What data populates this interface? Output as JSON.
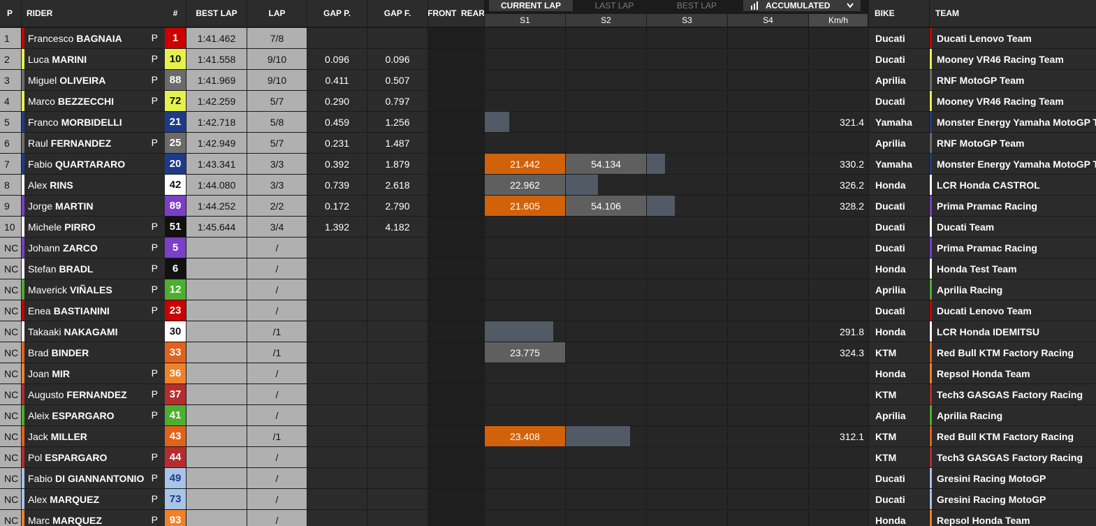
{
  "headers": {
    "pos": "P",
    "rider": "RIDER",
    "number": "#",
    "best_lap": "BEST LAP",
    "lap": "LAP",
    "gap_p": "GAP P.",
    "gap_f": "GAP F.",
    "front_rear": "FRONT  REAR",
    "bike": "BIKE",
    "team": "TEAM"
  },
  "lap_tabs": {
    "current": "CURRENT LAP",
    "last": "LAST LAP",
    "best": "BEST LAP",
    "mode": "ACCUMULATED"
  },
  "sector_headers": [
    "S1",
    "S2",
    "S3",
    "S4",
    "Km/h"
  ],
  "colors": {
    "orange_sector": "#d2620a",
    "gray_sector": "#5f5f5f",
    "slate_sector": "#525a66"
  },
  "riders": [
    {
      "pos": "1",
      "first": "Francesco",
      "last": "BAGNAIA",
      "p": "P",
      "num": "1",
      "num_bg": "#cc0000",
      "num_fg": "#ffffff",
      "accent": "#cc0000",
      "best": "1:41.462",
      "lap": "7/8",
      "gap_p": "",
      "gap_f": "",
      "s1": "",
      "s1_fill": 0,
      "s1_color": "",
      "s2": "",
      "s2_fill": 0,
      "s2_color": "",
      "s3_fill": 0,
      "speed": "",
      "bike": "Ducati",
      "team": "Ducati Lenovo Team",
      "team_accent": "#cc0000"
    },
    {
      "pos": "2",
      "first": "Luca",
      "last": "MARINI",
      "p": "P",
      "num": "10",
      "num_bg": "#e6f24c",
      "num_fg": "#111111",
      "accent": "#e6f24c",
      "best": "1:41.558",
      "lap": "9/10",
      "gap_p": "0.096",
      "gap_f": "0.096",
      "s1": "",
      "s1_fill": 0,
      "s1_color": "",
      "s2": "",
      "s2_fill": 0,
      "s2_color": "",
      "s3_fill": 0,
      "speed": "",
      "bike": "Ducati",
      "team": "Mooney VR46 Racing Team",
      "team_accent": "#e6f24c"
    },
    {
      "pos": "3",
      "first": "Miguel",
      "last": "OLIVEIRA",
      "p": "P",
      "num": "88",
      "num_bg": "#6b6b6b",
      "num_fg": "#ffffff",
      "accent": "#6b6b6b",
      "best": "1:41.969",
      "lap": "9/10",
      "gap_p": "0.411",
      "gap_f": "0.507",
      "s1": "",
      "s1_fill": 0,
      "s1_color": "",
      "s2": "",
      "s2_fill": 0,
      "s2_color": "",
      "s3_fill": 0,
      "speed": "",
      "bike": "Aprilia",
      "team": "RNF MotoGP Team",
      "team_accent": "#6b6b6b"
    },
    {
      "pos": "4",
      "first": "Marco",
      "last": "BEZZECCHI",
      "p": "P",
      "num": "72",
      "num_bg": "#e6f24c",
      "num_fg": "#111111",
      "accent": "#e6f24c",
      "best": "1:42.259",
      "lap": "5/7",
      "gap_p": "0.290",
      "gap_f": "0.797",
      "s1": "",
      "s1_fill": 0,
      "s1_color": "",
      "s2": "",
      "s2_fill": 0,
      "s2_color": "",
      "s3_fill": 0,
      "speed": "",
      "bike": "Ducati",
      "team": "Mooney VR46 Racing Team",
      "team_accent": "#e6f24c"
    },
    {
      "pos": "5",
      "first": "Franco",
      "last": "MORBIDELLI",
      "p": "",
      "num": "21",
      "num_bg": "#1e3a8a",
      "num_fg": "#ffffff",
      "accent": "#1e3a8a",
      "best": "1:42.718",
      "lap": "5/8",
      "gap_p": "0.459",
      "gap_f": "1.256",
      "s1": "",
      "s1_fill": 0.3,
      "s1_color": "#525a66",
      "s2": "",
      "s2_fill": 0,
      "s2_color": "",
      "s3_fill": 0,
      "speed": "321.4",
      "bike": "Yamaha",
      "team": "Monster Energy Yamaha MotoGP T...",
      "team_accent": "#1e3a8a"
    },
    {
      "pos": "6",
      "first": "Raul",
      "last": "FERNANDEZ",
      "p": "P",
      "num": "25",
      "num_bg": "#6b6b6b",
      "num_fg": "#ffffff",
      "accent": "#6b6b6b",
      "best": "1:42.949",
      "lap": "5/7",
      "gap_p": "0.231",
      "gap_f": "1.487",
      "s1": "",
      "s1_fill": 0,
      "s1_color": "",
      "s2": "",
      "s2_fill": 0,
      "s2_color": "",
      "s3_fill": 0,
      "speed": "",
      "bike": "Aprilia",
      "team": "RNF MotoGP Team",
      "team_accent": "#6b6b6b"
    },
    {
      "pos": "7",
      "first": "Fabio",
      "last": "QUARTARARO",
      "p": "",
      "num": "20",
      "num_bg": "#1e3a8a",
      "num_fg": "#ffffff",
      "accent": "#1e3a8a",
      "best": "1:43.341",
      "lap": "3/3",
      "gap_p": "0.392",
      "gap_f": "1.879",
      "s1": "21.442",
      "s1_fill": 1,
      "s1_color": "#d2620a",
      "s2": "54.134",
      "s2_fill": 1,
      "s2_color": "#5f5f5f",
      "s3_fill": 0.23,
      "speed": "330.2",
      "bike": "Yamaha",
      "team": "Monster Energy Yamaha MotoGP T...",
      "team_accent": "#1e3a8a"
    },
    {
      "pos": "8",
      "first": "Alex",
      "last": "RINS",
      "p": "",
      "num": "42",
      "num_bg": "#ffffff",
      "num_fg": "#111111",
      "accent": "#ffffff",
      "best": "1:44.080",
      "lap": "3/3",
      "gap_p": "0.739",
      "gap_f": "2.618",
      "s1": "22.962",
      "s1_fill": 1,
      "s1_color": "#5f5f5f",
      "s2": "",
      "s2_fill": 0.4,
      "s2_color": "#525a66",
      "s3_fill": 0,
      "speed": "326.2",
      "bike": "Honda",
      "team": "LCR Honda CASTROL",
      "team_accent": "#ffffff"
    },
    {
      "pos": "9",
      "first": "Jorge",
      "last": "MARTIN",
      "p": "",
      "num": "89",
      "num_bg": "#7b3fc9",
      "num_fg": "#ffffff",
      "accent": "#7b3fc9",
      "best": "1:44.252",
      "lap": "2/2",
      "gap_p": "0.172",
      "gap_f": "2.790",
      "s1": "21.605",
      "s1_fill": 1,
      "s1_color": "#d2620a",
      "s2": "54.106",
      "s2_fill": 1,
      "s2_color": "#5f5f5f",
      "s3_fill": 0.35,
      "speed": "328.2",
      "bike": "Ducati",
      "team": "Prima Pramac Racing",
      "team_accent": "#7b3fc9"
    },
    {
      "pos": "10",
      "first": "Michele",
      "last": "PIRRO",
      "p": "P",
      "num": "51",
      "num_bg": "#111111",
      "num_fg": "#ffffff",
      "accent": "#ffffff",
      "best": "1:45.644",
      "lap": "3/4",
      "gap_p": "1.392",
      "gap_f": "4.182",
      "s1": "",
      "s1_fill": 0,
      "s1_color": "",
      "s2": "",
      "s2_fill": 0,
      "s2_color": "",
      "s3_fill": 0,
      "speed": "",
      "bike": "Ducati",
      "team": "Ducati Team",
      "team_accent": "#ffffff"
    },
    {
      "pos": "NC",
      "first": "Johann",
      "last": "ZARCO",
      "p": "P",
      "num": "5",
      "num_bg": "#7b3fc9",
      "num_fg": "#ffffff",
      "accent": "#7b3fc9",
      "best": "",
      "lap": "/",
      "gap_p": "",
      "gap_f": "",
      "s1": "",
      "s1_fill": 0,
      "s1_color": "",
      "s2": "",
      "s2_fill": 0,
      "s2_color": "",
      "s3_fill": 0,
      "speed": "",
      "bike": "Ducati",
      "team": "Prima Pramac Racing",
      "team_accent": "#7b3fc9"
    },
    {
      "pos": "NC",
      "first": "Stefan",
      "last": "BRADL",
      "p": "P",
      "num": "6",
      "num_bg": "#111111",
      "num_fg": "#ffffff",
      "accent": "#ffffff",
      "best": "",
      "lap": "/",
      "gap_p": "",
      "gap_f": "",
      "s1": "",
      "s1_fill": 0,
      "s1_color": "",
      "s2": "",
      "s2_fill": 0,
      "s2_color": "",
      "s3_fill": 0,
      "speed": "",
      "bike": "Honda",
      "team": "Honda Test Team",
      "team_accent": "#ffffff"
    },
    {
      "pos": "NC",
      "first": "Maverick",
      "last": "VIÑALES",
      "p": "P",
      "num": "12",
      "num_bg": "#4caf2e",
      "num_fg": "#ffffff",
      "accent": "#4caf2e",
      "best": "",
      "lap": "/",
      "gap_p": "",
      "gap_f": "",
      "s1": "",
      "s1_fill": 0,
      "s1_color": "",
      "s2": "",
      "s2_fill": 0,
      "s2_color": "",
      "s3_fill": 0,
      "speed": "",
      "bike": "Aprilia",
      "team": "Aprilia Racing",
      "team_accent": "#4caf2e"
    },
    {
      "pos": "NC",
      "first": "Enea",
      "last": "BASTIANINI",
      "p": "P",
      "num": "23",
      "num_bg": "#cc0000",
      "num_fg": "#ffffff",
      "accent": "#cc0000",
      "best": "",
      "lap": "/",
      "gap_p": "",
      "gap_f": "",
      "s1": "",
      "s1_fill": 0,
      "s1_color": "",
      "s2": "",
      "s2_fill": 0,
      "s2_color": "",
      "s3_fill": 0,
      "speed": "",
      "bike": "Ducati",
      "team": "Ducati Lenovo Team",
      "team_accent": "#cc0000"
    },
    {
      "pos": "NC",
      "first": "Takaaki",
      "last": "NAKAGAMI",
      "p": "",
      "num": "30",
      "num_bg": "#ffffff",
      "num_fg": "#111111",
      "accent": "#ffffff",
      "best": "",
      "lap": "/1",
      "gap_p": "",
      "gap_f": "",
      "s1": "",
      "s1_fill": 0.85,
      "s1_color": "#525a66",
      "s2": "",
      "s2_fill": 0,
      "s2_color": "",
      "s3_fill": 0,
      "speed": "291.8",
      "bike": "Honda",
      "team": "LCR Honda IDEMITSU",
      "team_accent": "#ffffff"
    },
    {
      "pos": "NC",
      "first": "Brad",
      "last": "BINDER",
      "p": "",
      "num": "33",
      "num_bg": "#e2621b",
      "num_fg": "#ffffff",
      "accent": "#e2621b",
      "best": "",
      "lap": "/1",
      "gap_p": "",
      "gap_f": "",
      "s1": "23.775",
      "s1_fill": 1,
      "s1_color": "#5f5f5f",
      "s2": "",
      "s2_fill": 0,
      "s2_color": "",
      "s3_fill": 0,
      "speed": "324.3",
      "bike": "KTM",
      "team": "Red Bull KTM Factory Racing",
      "team_accent": "#e2621b"
    },
    {
      "pos": "NC",
      "first": "Joan",
      "last": "MIR",
      "p": "P",
      "num": "36",
      "num_bg": "#f0812a",
      "num_fg": "#ffffff",
      "accent": "#f0812a",
      "best": "",
      "lap": "/",
      "gap_p": "",
      "gap_f": "",
      "s1": "",
      "s1_fill": 0,
      "s1_color": "",
      "s2": "",
      "s2_fill": 0,
      "s2_color": "",
      "s3_fill": 0,
      "speed": "",
      "bike": "Honda",
      "team": "Repsol Honda Team",
      "team_accent": "#f0812a"
    },
    {
      "pos": "NC",
      "first": "Augusto",
      "last": "FERNANDEZ",
      "p": "P",
      "num": "37",
      "num_bg": "#b52d2d",
      "num_fg": "#ffffff",
      "accent": "#b52d2d",
      "best": "",
      "lap": "/",
      "gap_p": "",
      "gap_f": "",
      "s1": "",
      "s1_fill": 0,
      "s1_color": "",
      "s2": "",
      "s2_fill": 0,
      "s2_color": "",
      "s3_fill": 0,
      "speed": "",
      "bike": "KTM",
      "team": "Tech3 GASGAS Factory Racing",
      "team_accent": "#b52d2d"
    },
    {
      "pos": "NC",
      "first": "Aleix",
      "last": "ESPARGARO",
      "p": "P",
      "num": "41",
      "num_bg": "#4caf2e",
      "num_fg": "#ffffff",
      "accent": "#4caf2e",
      "best": "",
      "lap": "/",
      "gap_p": "",
      "gap_f": "",
      "s1": "",
      "s1_fill": 0,
      "s1_color": "",
      "s2": "",
      "s2_fill": 0,
      "s2_color": "",
      "s3_fill": 0,
      "speed": "",
      "bike": "Aprilia",
      "team": "Aprilia Racing",
      "team_accent": "#4caf2e"
    },
    {
      "pos": "NC",
      "first": "Jack",
      "last": "MILLER",
      "p": "",
      "num": "43",
      "num_bg": "#e2621b",
      "num_fg": "#ffffff",
      "accent": "#e2621b",
      "best": "",
      "lap": "/1",
      "gap_p": "",
      "gap_f": "",
      "s1": "23.408",
      "s1_fill": 1,
      "s1_color": "#d2620a",
      "s2": "",
      "s2_fill": 0.8,
      "s2_color": "#525a66",
      "s3_fill": 0,
      "speed": "312.1",
      "bike": "KTM",
      "team": "Red Bull KTM Factory Racing",
      "team_accent": "#e2621b"
    },
    {
      "pos": "NC",
      "first": "Pol",
      "last": "ESPARGARO",
      "p": "P",
      "num": "44",
      "num_bg": "#b52d2d",
      "num_fg": "#ffffff",
      "accent": "#b52d2d",
      "best": "",
      "lap": "/",
      "gap_p": "",
      "gap_f": "",
      "s1": "",
      "s1_fill": 0,
      "s1_color": "",
      "s2": "",
      "s2_fill": 0,
      "s2_color": "",
      "s3_fill": 0,
      "speed": "",
      "bike": "KTM",
      "team": "Tech3 GASGAS Factory Racing",
      "team_accent": "#b52d2d"
    },
    {
      "pos": "NC",
      "first": "Fabio",
      "last": "DI GIANNANTONIO",
      "p": "P",
      "num": "49",
      "num_bg": "#a8c4e8",
      "num_fg": "#1e3a8a",
      "accent": "#a8c4e8",
      "best": "",
      "lap": "/",
      "gap_p": "",
      "gap_f": "",
      "s1": "",
      "s1_fill": 0,
      "s1_color": "",
      "s2": "",
      "s2_fill": 0,
      "s2_color": "",
      "s3_fill": 0,
      "speed": "",
      "bike": "Ducati",
      "team": "Gresini Racing MotoGP",
      "team_accent": "#a8c4e8"
    },
    {
      "pos": "NC",
      "first": "Alex",
      "last": "MARQUEZ",
      "p": "P",
      "num": "73",
      "num_bg": "#a8c4e8",
      "num_fg": "#1e3a8a",
      "accent": "#a8c4e8",
      "best": "",
      "lap": "/",
      "gap_p": "",
      "gap_f": "",
      "s1": "",
      "s1_fill": 0,
      "s1_color": "",
      "s2": "",
      "s2_fill": 0,
      "s2_color": "",
      "s3_fill": 0,
      "speed": "",
      "bike": "Ducati",
      "team": "Gresini Racing MotoGP",
      "team_accent": "#a8c4e8"
    },
    {
      "pos": "NC",
      "first": "Marc",
      "last": "MARQUEZ",
      "p": "P",
      "num": "93",
      "num_bg": "#f0812a",
      "num_fg": "#ffffff",
      "accent": "#f0812a",
      "best": "",
      "lap": "/",
      "gap_p": "",
      "gap_f": "",
      "s1": "",
      "s1_fill": 0,
      "s1_color": "",
      "s2": "",
      "s2_fill": 0,
      "s2_color": "",
      "s3_fill": 0,
      "speed": "",
      "bike": "Honda",
      "team": "Repsol Honda Team",
      "team_accent": "#f0812a"
    }
  ]
}
